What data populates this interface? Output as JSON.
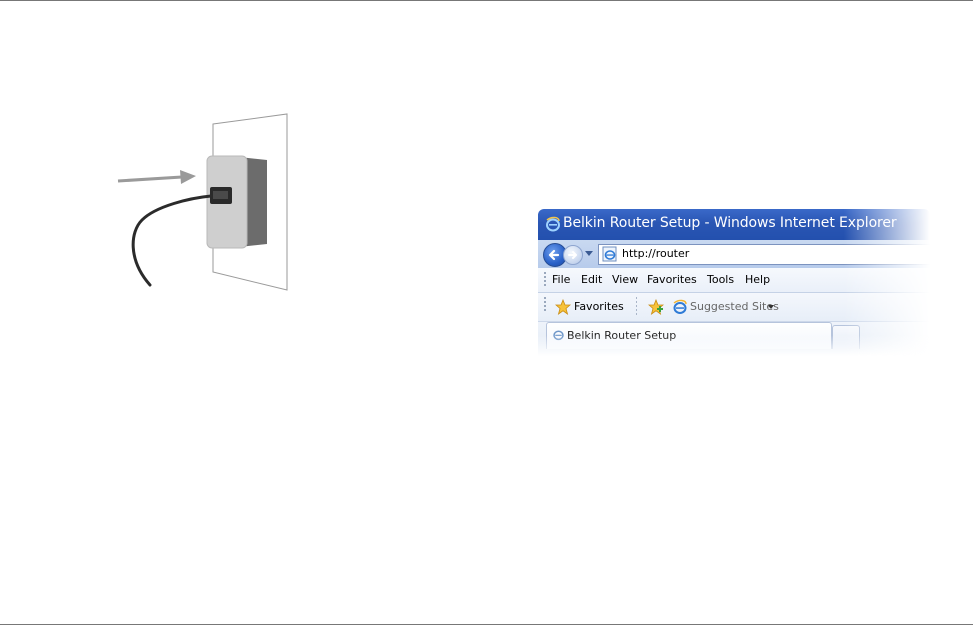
{
  "window": {
    "title": "Belkin Router Setup - Windows Internet Explorer"
  },
  "address_bar": {
    "url": "http://router"
  },
  "menu": {
    "items": [
      "File",
      "Edit",
      "View",
      "Favorites",
      "Tools",
      "Help"
    ]
  },
  "favorites_bar": {
    "favorites_label": "Favorites",
    "suggested_sites_label": "Suggested Sites"
  },
  "tabs": {
    "active_label": "Belkin Router Setup"
  },
  "colors": {
    "titlebar": "#2a56b4",
    "arrow": "#9a9a9a",
    "outlet_front": "#c9c9c9",
    "outlet_side": "#6c6c6c"
  },
  "icons": {
    "title": "ie-logo-icon",
    "back": "back-arrow-icon",
    "forward": "forward-arrow-icon",
    "address": "ie-page-icon",
    "favorites": "favorites-star-icon",
    "add_favorite": "add-favorite-icon",
    "suggested": "ie-suggested-icon",
    "tab": "ie-tab-icon"
  }
}
